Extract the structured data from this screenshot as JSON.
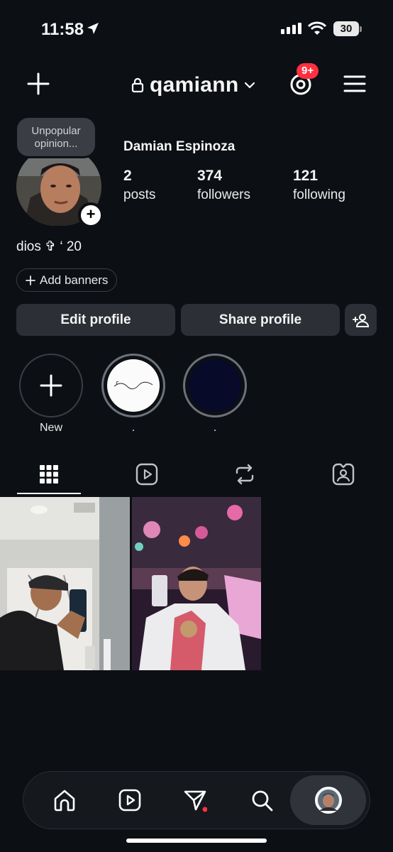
{
  "status_bar": {
    "time": "11:58",
    "battery": "30"
  },
  "header": {
    "username": "qamiann",
    "notification_badge": "9+"
  },
  "profile": {
    "note": "Unpopular opinion...",
    "full_name": "Damian Espinoza",
    "stats": [
      {
        "count": "2",
        "label": "posts"
      },
      {
        "count": "374",
        "label": "followers"
      },
      {
        "count": "121",
        "label": "following"
      }
    ],
    "bio": "dios ✞ ‘ 20",
    "add_banners_label": "Add banners"
  },
  "actions": {
    "edit_profile": "Edit profile",
    "share_profile": "Share profile"
  },
  "highlights": [
    {
      "label": "New"
    },
    {
      "label": "."
    },
    {
      "label": "."
    }
  ],
  "tabs": [
    "grid-icon",
    "reels-icon",
    "reposts-icon",
    "tagged-icon"
  ],
  "bottom_nav": [
    "home-icon",
    "reels-icon",
    "direct-icon",
    "search-icon",
    "profile-avatar"
  ],
  "colors": {
    "background": "#0c0f14",
    "button": "#2c2f35",
    "badge": "#ff3040"
  }
}
